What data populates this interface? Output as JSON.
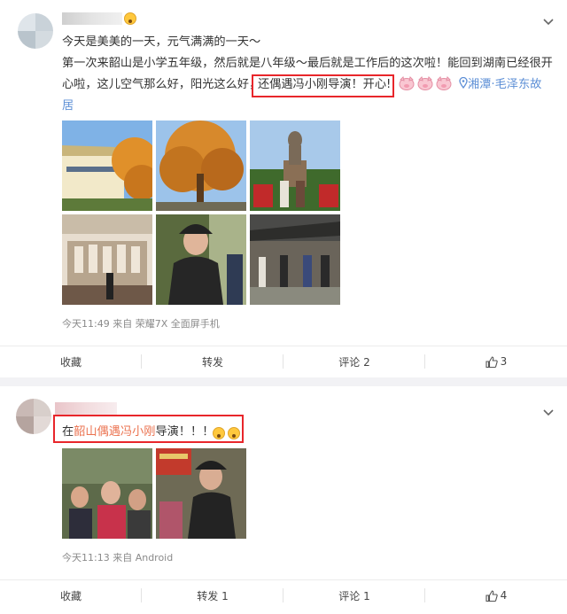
{
  "post1": {
    "line1": "今天是美美的一天，元气满满的一天～",
    "line2": "第一次来韶山是小学五年级，然后就是八年级～最后就是工作后的这次啦！能回到湖南已经很开",
    "line3_pre": "心啦，这儿空气那么好，阳光这么好，",
    "line3_highlight": "还偶遇冯小刚导演！开心!",
    "location_city": "湘潭",
    "location_place_1": "毛泽东故",
    "location_place_2": "居",
    "meta": "今天11:49 来自 荣耀7X 全面屏手机",
    "actions": {
      "collect": "收藏",
      "repost": "转发",
      "comment": "评论 2",
      "like": "3"
    }
  },
  "post2": {
    "text_pre": "在",
    "text_link": "韶山偶遇冯小刚",
    "text_post": "导演！！！",
    "meta": "今天11:13 来自 Android",
    "actions": {
      "collect": "收藏",
      "repost": "转发 1",
      "comment": "评论 1",
      "like": "4"
    }
  },
  "colors": {
    "highlight_box": "#e8262b",
    "link": "#eb7350",
    "location": "#5d8fd6"
  },
  "icons": [
    "chevron-down-icon",
    "location-pin-icon",
    "thumb-up-icon",
    "pig-face-emoji",
    "shocked-face-emoji"
  ]
}
